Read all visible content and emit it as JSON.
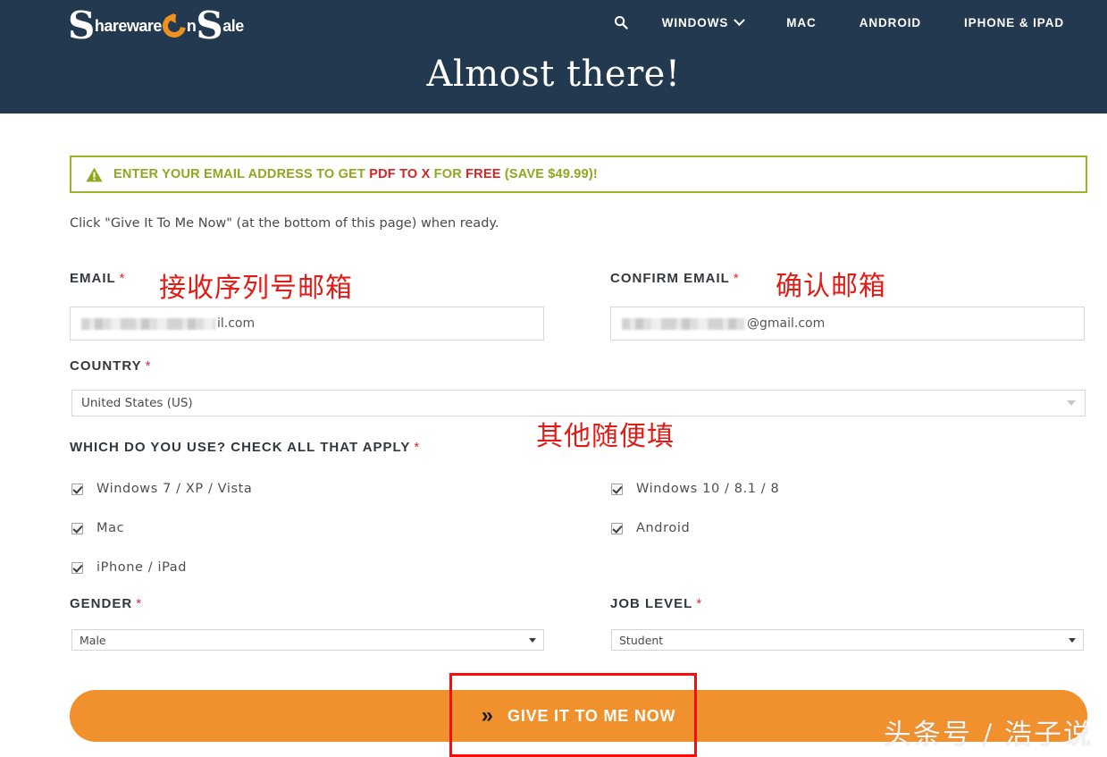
{
  "header": {
    "logo": {
      "part1": "S",
      "part2": "hareware",
      "ring_icon": "circular-arrow-icon",
      "part3": "n",
      "part4": "S",
      "part5": "ale"
    },
    "search_icon": "search-icon",
    "nav": [
      {
        "label": "WINDOWS",
        "has_caret": true,
        "caret_icon": "chevron-down-icon"
      },
      {
        "label": "MAC",
        "has_caret": false
      },
      {
        "label": "ANDROID",
        "has_caret": false
      },
      {
        "label": "IPHONE & IPAD",
        "has_caret": false
      }
    ],
    "hero_title": "Almost there!",
    "bg_color": "#22394f"
  },
  "banner": {
    "icon": "warning-triangle-icon",
    "text_1": "ENTER YOUR EMAIL ADDRESS TO GET ",
    "product": "PDF TO X",
    "text_2": " FOR ",
    "free": "FREE",
    "text_3": " (SAVE $49.99)!",
    "border_color": "#9cb326",
    "text_color": "#8fa81f",
    "accent_color": "#d02525"
  },
  "instruction": "Click \"Give It To Me Now\" (at the bottom of this page) when ready.",
  "form": {
    "email": {
      "label": "EMAIL",
      "required": "*",
      "annotation": "接收序列号邮箱",
      "value_visible_suffix": "il.com",
      "value_masked": true
    },
    "confirm_email": {
      "label": "CONFIRM EMAIL",
      "required": "*",
      "annotation": "确认邮箱",
      "value_visible_suffix": "@gmail.com",
      "value_masked": true
    },
    "country": {
      "label": "COUNTRY",
      "required": "*",
      "value": "United States (US)",
      "caret_icon": "dropdown-arrow-icon"
    },
    "annotation_other": "其他随便填",
    "checkbox_group": {
      "label": "WHICH DO YOU USE? CHECK ALL THAT APPLY",
      "required": "*",
      "left_items": [
        {
          "label": "Windows 7 / XP / Vista",
          "checked": true
        },
        {
          "label": "Mac",
          "checked": true
        },
        {
          "label": "iPhone / iPad",
          "checked": true
        }
      ],
      "right_items": [
        {
          "label": "Windows 10 / 8.1 / 8",
          "checked": true
        },
        {
          "label": "Android",
          "checked": true
        }
      ]
    },
    "gender": {
      "label": "GENDER",
      "required": "*",
      "value": "Male",
      "caret_icon": "dropdown-arrow-icon"
    },
    "job_level": {
      "label": "JOB LEVEL",
      "required": "*",
      "value": "Student",
      "caret_icon": "dropdown-arrow-icon"
    }
  },
  "submit": {
    "icon": "double-chevron-right-icon",
    "label": "GIVE IT TO ME NOW",
    "color": "#f0912d",
    "highlight_color": "#fd0a0a"
  },
  "watermark": "头条号 / 浩子说"
}
